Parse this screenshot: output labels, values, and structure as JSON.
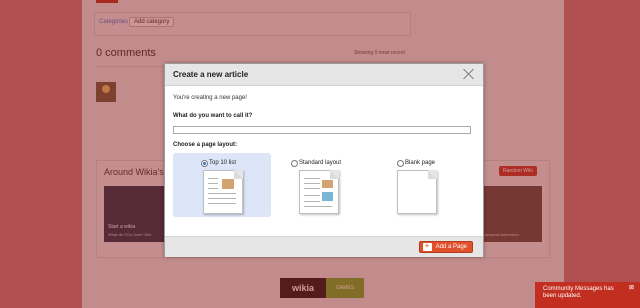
{
  "background": {
    "categories_label": "Categories",
    "add_category_label": "Add category",
    "comments_title": "0 comments",
    "showing_text": "Showing 0 most recent",
    "around_title": "Around Wikia's n",
    "random_wiki_label": "Random Wiki",
    "tile_left_title": "Start a wikia",
    "tile_left_sub": "What do YOU love? She",
    "tile_right_sub": "at personal adventure.",
    "footer_logo_text": "wikia",
    "footer_logo_sub": "GAMES"
  },
  "toast": {
    "text": "Community Messages has been updated.",
    "close_icon": "close-icon"
  },
  "modal": {
    "title": "Create a new article",
    "intro": "You're creating a new page!",
    "question": "What do you want to call it?",
    "name_value": "",
    "layout_label": "Choose a page layout:",
    "options": [
      {
        "label": "Top 10 list",
        "selected": true
      },
      {
        "label": "Standard layout",
        "selected": false
      },
      {
        "label": "Blank page",
        "selected": false
      }
    ],
    "add_button_label": "Add a Page"
  },
  "colors": {
    "accent": "#e0502c",
    "selected_bg": "#dde6f8",
    "toast_bg": "#c22e1f"
  }
}
